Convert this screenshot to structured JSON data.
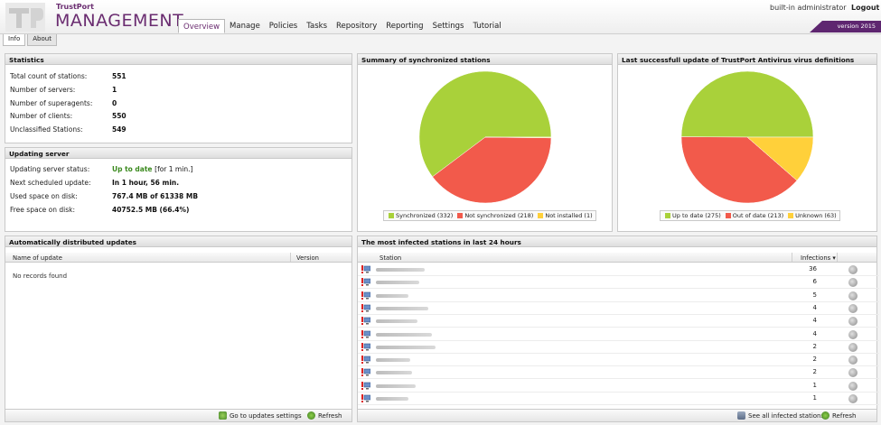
{
  "header": {
    "logo_top": "TrustPort",
    "logo_main": "MANAGEMENT",
    "user": "built-in administrator",
    "logout": "Logout",
    "version": "version 2015"
  },
  "nav": [
    "Overview",
    "Manage",
    "Policies",
    "Tasks",
    "Repository",
    "Reporting",
    "Settings",
    "Tutorial"
  ],
  "subtabs": [
    "Info",
    "About"
  ],
  "statistics": {
    "title": "Statistics",
    "rows": [
      {
        "label": "Total count of stations:",
        "value": "551"
      },
      {
        "label": "Number of servers:",
        "value": "1"
      },
      {
        "label": "Number of superagents:",
        "value": "0"
      },
      {
        "label": "Number of clients:",
        "value": "550"
      },
      {
        "label": "Unclassified Stations:",
        "value": "549"
      }
    ]
  },
  "updating_server": {
    "title": "Updating server",
    "status_label": "Updating server status:",
    "status_value": "Up to date",
    "status_note": "[for 1 min.]",
    "next_label": "Next scheduled update:",
    "next_value": "In 1 hour, 56 min.",
    "used_label": "Used space on disk:",
    "used_value": "767.4 MB of 61338 MB",
    "free_label": "Free space on disk:",
    "free_value": "40752.5 MB (66.4%)"
  },
  "sync_chart": {
    "title": "Summary of synchronized stations",
    "legend": [
      "Synchronized (332)",
      "Not synchronized (218)",
      "Not installed (1)"
    ]
  },
  "update_chart": {
    "title": "Last successfull update of TrustPort Antivirus virus definitions",
    "legend": [
      "Up to date (275)",
      "Out of date (213)",
      "Unknown (63)"
    ]
  },
  "chart_data": [
    {
      "type": "pie",
      "categories": [
        "Synchronized",
        "Not synchronized",
        "Not installed"
      ],
      "values": [
        332,
        218,
        1
      ],
      "colors": [
        "#a9d13a",
        "#f25a4b",
        "#ffd03a"
      ]
    },
    {
      "type": "pie",
      "categories": [
        "Up to date",
        "Out of date",
        "Unknown"
      ],
      "values": [
        275,
        213,
        63
      ],
      "colors": [
        "#a9d13a",
        "#f25a4b",
        "#ffd03a"
      ]
    }
  ],
  "auto_updates": {
    "title": "Automatically distributed updates",
    "col_name": "Name of update",
    "col_version": "Version",
    "empty": "No records found",
    "btn_settings": "Go to updates settings",
    "btn_refresh": "Refresh"
  },
  "infected": {
    "title": "The most infected stations in last 24 hours",
    "col_station": "Station",
    "col_infections": "Infections",
    "counts": [
      "36",
      "6",
      "5",
      "4",
      "4",
      "4",
      "2",
      "2",
      "2",
      "1",
      "1"
    ],
    "btn_all": "See all infected stations",
    "btn_refresh": "Refresh"
  },
  "colors": {
    "brand": "#6a2c70",
    "green": "#a9d13a",
    "red": "#f25a4b",
    "yellow": "#ffd03a"
  }
}
